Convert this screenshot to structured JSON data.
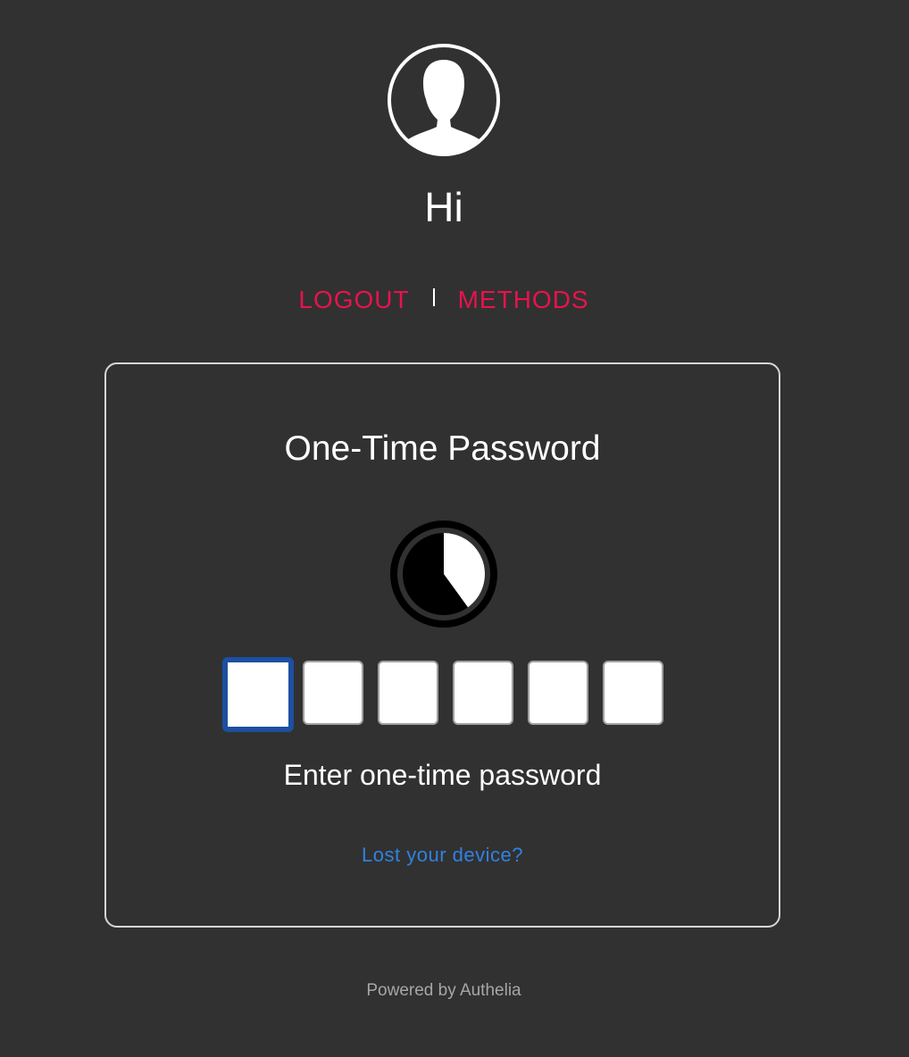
{
  "header": {
    "avatar_icon": "user-avatar-icon",
    "greeting": "Hi"
  },
  "actions": {
    "logout_label": "LOGOUT",
    "methods_label": "METHODS",
    "color": "#e8134d"
  },
  "card": {
    "title": "One-Time Password",
    "timer_icon": "countdown-timer-icon",
    "timer_remaining_fraction": 0.6,
    "otp_digits": [
      "",
      "",
      "",
      "",
      "",
      ""
    ],
    "hint": "Enter one-time password",
    "lost_device_label": "Lost your device?",
    "link_color": "#2f82e0"
  },
  "footer": {
    "powered_by": "Powered by Authelia"
  }
}
